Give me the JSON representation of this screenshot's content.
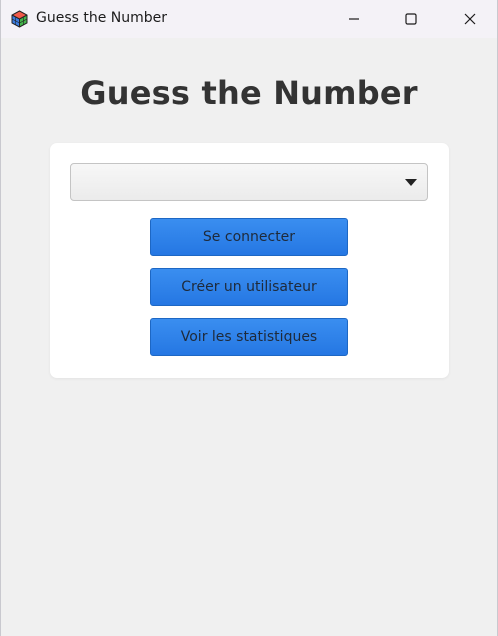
{
  "window": {
    "title": "Guess the Number",
    "controls": {
      "minimize": "minimize-icon",
      "maximize": "maximize-icon",
      "close": "close-icon"
    }
  },
  "main": {
    "heading": "Guess the Number",
    "user_select": {
      "value": ""
    },
    "buttons": {
      "login": "Se connecter",
      "create_user": "Créer un utilisateur",
      "stats": "Voir les statistiques"
    }
  },
  "colors": {
    "accent": "#2a7de8",
    "background": "#f0f0f0",
    "card": "#ffffff",
    "heading": "#333333"
  }
}
